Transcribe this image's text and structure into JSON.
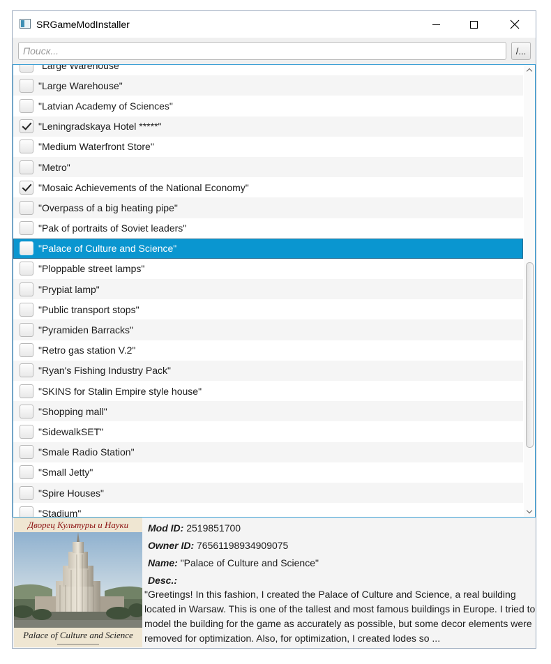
{
  "window": {
    "title": "SRGameModInstaller"
  },
  "search": {
    "placeholder": "Поиск...",
    "value": ""
  },
  "browse_button": {
    "label": "/..."
  },
  "mods": [
    {
      "label": "\"Large Warehouse\"",
      "checked": false
    },
    {
      "label": "\"Large Warehouse\"",
      "checked": false
    },
    {
      "label": "\"Latvian Academy of Sciences\"",
      "checked": false
    },
    {
      "label": "\"Leningradskaya Hotel *****\"",
      "checked": true
    },
    {
      "label": "\"Medium Waterfront Store\"",
      "checked": false
    },
    {
      "label": "\"Metro\"",
      "checked": false
    },
    {
      "label": "\"Mosaic Achievements of the National Economy\"",
      "checked": true
    },
    {
      "label": "\"Overpass of a big heating pipe\"",
      "checked": false
    },
    {
      "label": "\"Pak of portraits of Soviet leaders\"",
      "checked": false
    },
    {
      "label": "\"Palace of Culture and Science\"",
      "checked": false,
      "selected": true
    },
    {
      "label": "\"Ploppable street lamps\"",
      "checked": false
    },
    {
      "label": "\"Prypiat lamp\"",
      "checked": false
    },
    {
      "label": "\"Public transport stops\"",
      "checked": false
    },
    {
      "label": "\"Pyramiden Barracks\"",
      "checked": false
    },
    {
      "label": "\"Retro gas station V.2\"",
      "checked": false
    },
    {
      "label": "\"Ryan's Fishing Industry Pack\"",
      "checked": false
    },
    {
      "label": "\"SKINS for Stalin Empire style house\"",
      "checked": false
    },
    {
      "label": "\"Shopping mall\"",
      "checked": false
    },
    {
      "label": "\"SidewalkSET\"",
      "checked": false
    },
    {
      "label": "\"Smale Radio Station\"",
      "checked": false
    },
    {
      "label": "\"Small Jetty\"",
      "checked": false
    },
    {
      "label": "\"Spire Houses\"",
      "checked": false
    },
    {
      "label": "\"Stadium\"",
      "checked": false
    }
  ],
  "details": {
    "preview_caption_top": "Дворец Культуры и Науки",
    "preview_caption_bottom": "Palace of Culture and Science",
    "mod_id_label": "Mod ID:",
    "mod_id": "2519851700",
    "owner_id_label": "Owner ID:",
    "owner_id": "76561198934909075",
    "name_label": "Name:",
    "name": "\"Palace of Culture and Science\"",
    "desc_label": "Desc.:",
    "description": "\"Greetings! In this fashion, I created the Palace of Culture and Science, a real building located in Warsaw. This is one of the tallest and most famous buildings in Europe. I tried to model the building for the game as accurately as possible, but some decor elements were removed for optimization. Also, for optimization, I created lodes so ..."
  },
  "colors": {
    "selection": "#0a96d0",
    "list_border": "#3ea0d5",
    "caption_red": "#8c1212"
  }
}
